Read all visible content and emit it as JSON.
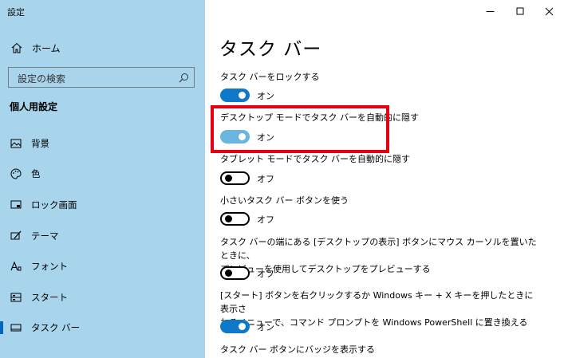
{
  "app": {
    "title": "設定"
  },
  "sidebar": {
    "home_label": "ホーム",
    "search_placeholder": "設定の検索",
    "section_title": "個人用設定",
    "items": [
      {
        "label": "背景",
        "icon": "image-icon"
      },
      {
        "label": "色",
        "icon": "palette-icon"
      },
      {
        "label": "ロック画面",
        "icon": "lock-screen-icon"
      },
      {
        "label": "テーマ",
        "icon": "theme-brush-icon"
      },
      {
        "label": "フォント",
        "icon": "font-icon"
      },
      {
        "label": "スタート",
        "icon": "start-icon"
      },
      {
        "label": "タスク バー",
        "icon": "taskbar-icon",
        "active": true
      }
    ]
  },
  "main": {
    "title": "タスク バー",
    "settings": [
      {
        "label": "タスク バーをロックする",
        "state": "オン",
        "on": true
      },
      {
        "label": "デスクトップ モードでタスク バーを自動的に隠す",
        "state": "オン",
        "on": true
      },
      {
        "label": "タブレット モードでタスク バーを自動的に隠す",
        "state": "オフ",
        "on": false
      },
      {
        "label": "小さいタスク バー ボタンを使う",
        "state": "オフ",
        "on": false
      },
      {
        "label_line1": "タスク バーの端にある [デスクトップの表示] ボタンにマウス カーソルを置いたときに、",
        "label_line2": "プレビューを使用してデスクトップをプレビューする",
        "state": "オフ",
        "on": false
      },
      {
        "label_line1": "[スタート] ボタンを右クリックするか Windows キー + X キーを押したときに表示さ",
        "label_line2": "れるメニューで、コマンド プロンプトを Windows PowerShell に置き換える",
        "state": "オン",
        "on": true
      },
      {
        "label": "タスク バー ボタンにバッジを表示する"
      }
    ]
  },
  "colors": {
    "sidebar_bg": "#a8d4ec",
    "toggle_on": "#0e79c8",
    "highlight": "#e60012"
  }
}
